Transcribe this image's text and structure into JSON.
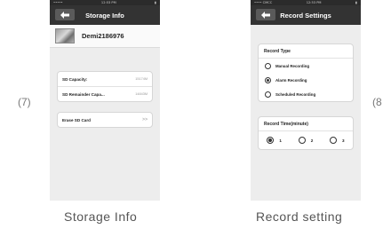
{
  "left_label": "(7)",
  "right_label": "(8",
  "storage_screen": {
    "status_left": "•••••",
    "status_center": "12:53 PM",
    "nav_title": "Storage Info",
    "device_name": "Demi2186976",
    "rows": [
      {
        "label": "SD Capacity:",
        "value": "15174M"
      },
      {
        "label": "SD Remainder Capa...",
        "value": "14843M"
      }
    ],
    "erase_label": "Erase SD Card",
    "erase_chevron": ">>",
    "caption": "Storage Info"
  },
  "record_screen": {
    "status_left": "•••• CMCC",
    "status_center": "12:53 PM",
    "nav_title": "Record Settings",
    "record_type_title": "Record Type",
    "record_types": [
      {
        "label": "Manual Recording",
        "selected": false
      },
      {
        "label": "Alarm Recording",
        "selected": true
      },
      {
        "label": "Scheduled Recording",
        "selected": false
      }
    ],
    "record_time_title": "Record Time(minute)",
    "record_times": [
      {
        "label": "1",
        "selected": true
      },
      {
        "label": "2",
        "selected": false
      },
      {
        "label": "3",
        "selected": false
      }
    ],
    "caption": "Record setting"
  }
}
